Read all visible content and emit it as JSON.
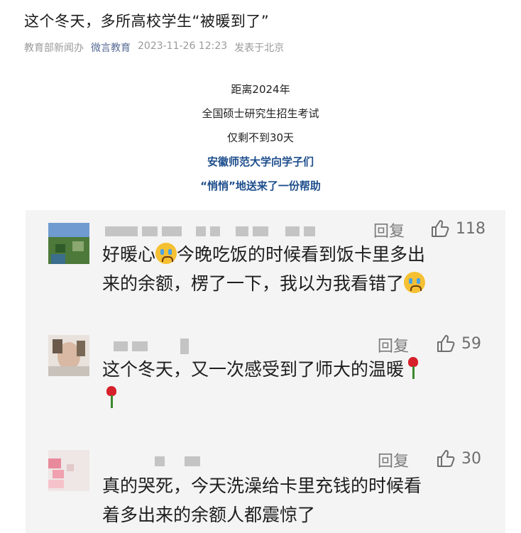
{
  "article": {
    "title": "这个冬天，多所高校学生“被暖到了”",
    "source": "教育部新闻办",
    "account": "微言教育",
    "datetime": "2023-11-26 12:23",
    "location": "发表于北京"
  },
  "intro": {
    "line1": "距离2024年",
    "line2": "全国硕士研究生招生考试",
    "line3": "仅剩不到30天",
    "line4": "安徽师范大学向学子们",
    "line5": "“悄悄”地送来了一份帮助"
  },
  "colors": {
    "accent_blue": "#1e4e8c",
    "link_blue": "#576b95",
    "card_bg": "#f4f4f4"
  },
  "comments": [
    {
      "reply_label": "回复",
      "likes": "118",
      "text_a": "好暖心",
      "text_b": "今晚吃饭的时候看到饭卡里多出",
      "text_c": "来的余额，楞了一下，我以为我看错了",
      "emoji": "crying-face-emoji"
    },
    {
      "reply_label": "回复",
      "likes": "59",
      "text_a": "这个冬天，又一次感受到了师大的温暖",
      "emoji": "rose-emoji"
    },
    {
      "reply_label": "回复",
      "likes": "30",
      "text_a": "真的哭死，今天洗澡给卡里充钱的时候看",
      "text_b": "着多出来的余额人都震惊了"
    }
  ]
}
